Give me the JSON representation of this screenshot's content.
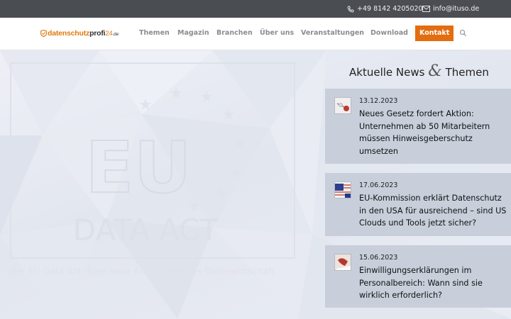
{
  "topbar": {
    "phone": "+49 8142 4205020",
    "email": "info@ituso.de"
  },
  "logo": {
    "part1": "datenschutz",
    "part2": "profi",
    "part3": "24",
    "part4": ".de"
  },
  "nav": [
    "Themen",
    "Magazin",
    "Branchen",
    "Über uns",
    "Veranstaltungen",
    "Download"
  ],
  "contact_label": "Kontakt",
  "hero": {
    "line1": "EU",
    "line2": "DATA ACT",
    "caption": "Der EU Data Act: Eine neue Ära für Europas Datenwirtschaft"
  },
  "news": {
    "heading_left": "Aktuelle News",
    "heading_amp": "&",
    "heading_right": "Themen",
    "items": [
      {
        "date": "13.12.2023",
        "title": "Neues Gesetz fordert Aktion: Unternehmen ab 50 Mitarbeitern müssen Hinweisgeberschutz umsetzen"
      },
      {
        "date": "17.06.2023",
        "title": "EU-Kommission erklärt Datenschutz in den USA für ausreichend – sind US Clouds und Tools jetzt sicher?"
      },
      {
        "date": "15.06.2023",
        "title": "Einwilligungserklärungen im Personalbereich: Wann sind sie wirklich erforderlich?"
      }
    ]
  },
  "colors": {
    "topbar": "#4a4d52",
    "accent": "#e36d0f",
    "card": "#c8cfdb"
  }
}
